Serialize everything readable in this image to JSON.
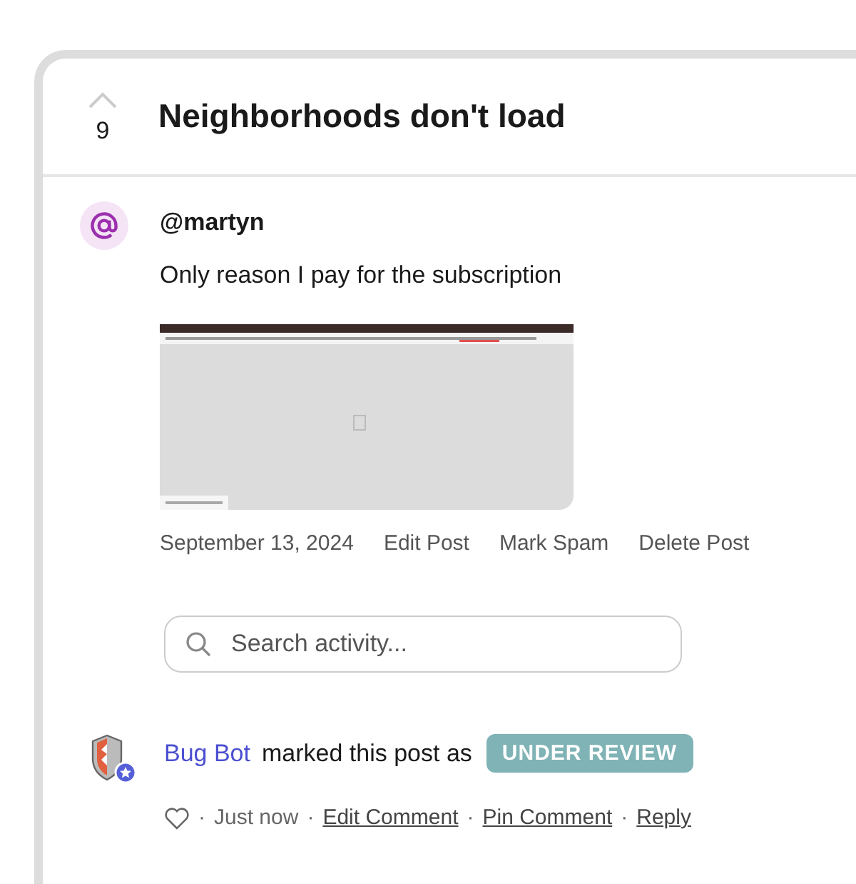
{
  "post": {
    "votes": "9",
    "title": "Neighborhoods don't load"
  },
  "comment": {
    "author": "@martyn",
    "text": "Only reason I pay for the subscription",
    "date": "September 13, 2024",
    "actions": [
      "Edit Post",
      "Mark Spam",
      "Delete Post"
    ]
  },
  "search": {
    "placeholder": "Search activity..."
  },
  "activity": {
    "actor": "Bug Bot",
    "text": "marked this post as",
    "status": {
      "label": "UNDER REVIEW",
      "color": "#7fb3b5"
    },
    "liked": false,
    "separator": "·",
    "time": "Just now",
    "actions": [
      "Edit Comment",
      "Pin Comment",
      "Reply"
    ]
  }
}
